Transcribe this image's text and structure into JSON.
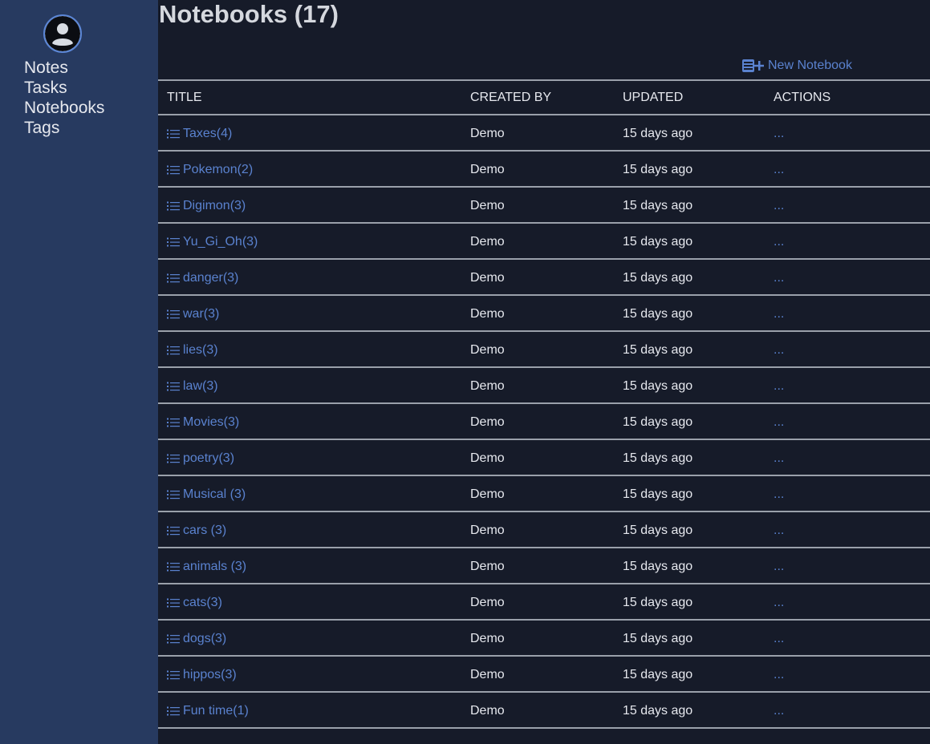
{
  "sidebar": {
    "avatar_icon": "user-circle-icon",
    "nav": [
      {
        "label": "Notes"
      },
      {
        "label": "Tasks"
      },
      {
        "label": "Notebooks"
      },
      {
        "label": "Tags"
      }
    ]
  },
  "main": {
    "title": "Notebooks (17)",
    "new_notebook": {
      "label": "New Notebook",
      "icon": "add-notebook-icon"
    },
    "columns": [
      "TITLE",
      "CREATED BY",
      "UPDATED",
      "ACTIONS"
    ],
    "rows": [
      {
        "title": "Taxes(4)",
        "created_by": "Demo",
        "updated": "15 days ago",
        "actions": "..."
      },
      {
        "title": "Pokemon(2)",
        "created_by": "Demo",
        "updated": "15 days ago",
        "actions": "..."
      },
      {
        "title": "Digimon(3)",
        "created_by": "Demo",
        "updated": "15 days ago",
        "actions": "..."
      },
      {
        "title": "Yu_Gi_Oh(3)",
        "created_by": "Demo",
        "updated": "15 days ago",
        "actions": "..."
      },
      {
        "title": "danger(3)",
        "created_by": "Demo",
        "updated": "15 days ago",
        "actions": "..."
      },
      {
        "title": "war(3)",
        "created_by": "Demo",
        "updated": "15 days ago",
        "actions": "..."
      },
      {
        "title": "lies(3)",
        "created_by": "Demo",
        "updated": "15 days ago",
        "actions": "..."
      },
      {
        "title": "law(3)",
        "created_by": "Demo",
        "updated": "15 days ago",
        "actions": "..."
      },
      {
        "title": "Movies(3)",
        "created_by": "Demo",
        "updated": "15 days ago",
        "actions": "..."
      },
      {
        "title": "poetry(3)",
        "created_by": "Demo",
        "updated": "15 days ago",
        "actions": "..."
      },
      {
        "title": "Musical (3)",
        "created_by": "Demo",
        "updated": "15 days ago",
        "actions": "..."
      },
      {
        "title": "cars (3)",
        "created_by": "Demo",
        "updated": "15 days ago",
        "actions": "..."
      },
      {
        "title": "animals (3)",
        "created_by": "Demo",
        "updated": "15 days ago",
        "actions": "..."
      },
      {
        "title": "cats(3)",
        "created_by": "Demo",
        "updated": "15 days ago",
        "actions": "..."
      },
      {
        "title": "dogs(3)",
        "created_by": "Demo",
        "updated": "15 days ago",
        "actions": "..."
      },
      {
        "title": "hippos(3)",
        "created_by": "Demo",
        "updated": "15 days ago",
        "actions": "..."
      },
      {
        "title": "Fun time(1)",
        "created_by": "Demo",
        "updated": "15 days ago",
        "actions": "..."
      }
    ],
    "row_icon": "list-icon"
  },
  "colors": {
    "sidebar_bg": "#273a60",
    "main_bg": "#161b29",
    "accent": "#5a82cf",
    "text": "#e6e8ee"
  }
}
